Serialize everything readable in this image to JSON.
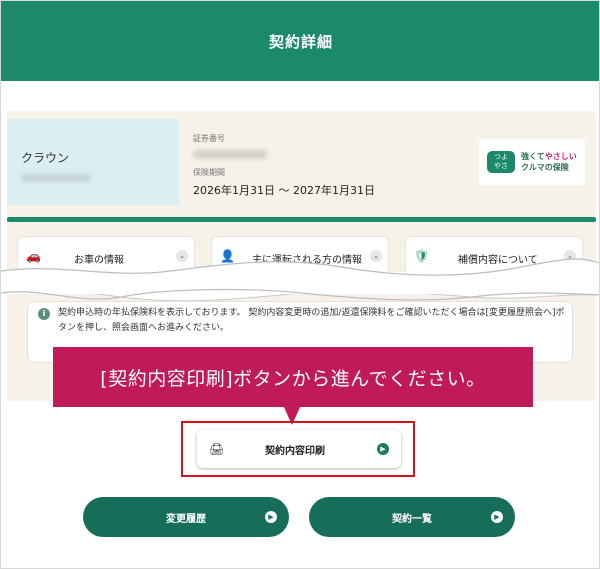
{
  "header": {
    "title": "契約詳細"
  },
  "card": {
    "car_name": "クラウン",
    "policy_number_label": "証券番号",
    "period_label": "保険期間",
    "period_value": "2026年1月31日 ～ 2027年1月31日"
  },
  "logo": {
    "mark_line1": "つよ",
    "mark_line2": "やさ",
    "line1_a": "強くて",
    "line1_b": "やさしい",
    "line2": "クルマの保険"
  },
  "tabs": [
    {
      "label": "お車の情報",
      "icon": "car-icon"
    },
    {
      "label": "主に運転される方の情報",
      "icon": "person-icon"
    },
    {
      "label": "補償内容について",
      "icon": "shield-icon"
    }
  ],
  "info": {
    "text": "契約申込時の年払保険料を表示しております。 契約内容変更時の追加/返還保険料をご確認いただく場合は[変更履歴照会へ]ボタンを押し、照会画面へお進みください。"
  },
  "callout": {
    "text": "[契約内容印刷]ボタンから進んでください。"
  },
  "buttons": {
    "print": "契約内容印刷",
    "history": "変更履歴",
    "list": "契約一覧"
  },
  "colors": {
    "brand_green": "#1b8a6b",
    "button_green": "#166e59",
    "callout": "#c01b58",
    "highlight_border": "#d3141d",
    "beige": "#f6f1e9"
  }
}
